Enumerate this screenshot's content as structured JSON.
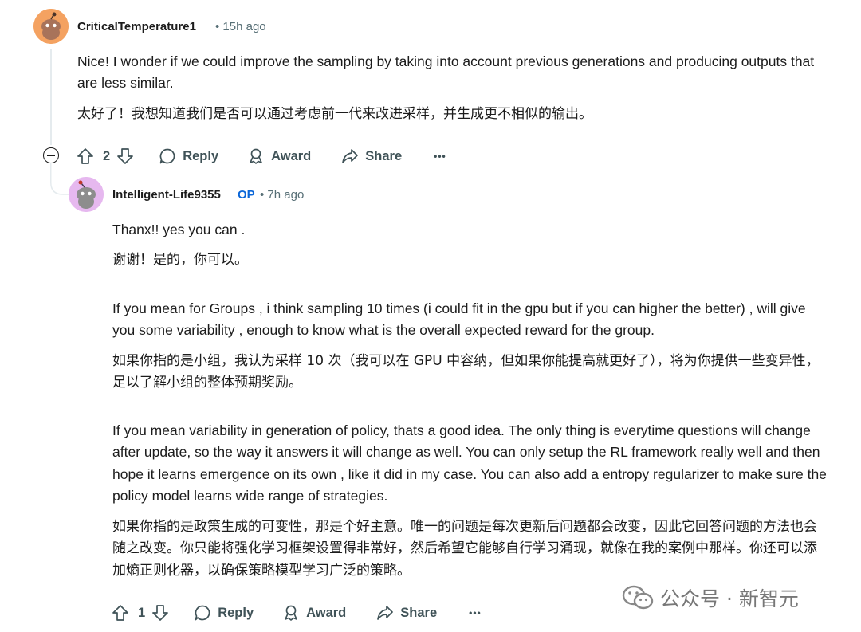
{
  "comment": {
    "username": "CriticalTemperature1",
    "time": "15h ago",
    "text_en": "Nice! I wonder if we could improve the sampling by taking into account previous generations and producing outputs that are less similar.",
    "text_cn": "太好了！我想知道我们是否可以通过考虑前一代来改进采样，并生成更不相似的输出。",
    "votes": "2",
    "reply_label": "Reply",
    "award_label": "Award",
    "share_label": "Share",
    "more_label": "•••"
  },
  "reply": {
    "username": "Intelligent-Life9355",
    "op_badge": "OP",
    "time": "7h ago",
    "p1_en": "Thanx!! yes you can .",
    "p1_cn": "谢谢！是的，你可以。",
    "p2_en": "If you mean for Groups , i think sampling 10 times (i could fit in the gpu but if you can higher the better) , will give you some variability , enough to know what is the overall expected reward for the group.",
    "p2_cn": "如果你指的是小组，我认为采样 10 次（我可以在 GPU 中容纳，但如果你能提高就更好了），将为你提供一些变异性，足以了解小组的整体预期奖励。",
    "p3_en": "If you mean variability in generation of policy, thats a good idea. The only thing is everytime questions will change after update, so the way it answers it will change as well. You can only setup the RL framework really well and then hope it learns emergence on its own , like it did in my case. You can also add a entropy regularizer to make sure the policy model learns wide range of strategies.",
    "p3_cn": "如果你指的是政策生成的可变性，那是个好主意。唯一的问题是每次更新后问题都会改变，因此它回答问题的方法也会随之改变。你只能将强化学习框架设置得非常好，然后希望它能够自行学习涌现，就像在我的案例中那样。你还可以添加熵正则化器，以确保策略模型学习广泛的策略。",
    "votes": "1",
    "reply_label": "Reply",
    "award_label": "Award",
    "share_label": "Share",
    "more_label": "•••"
  },
  "watermark": {
    "text": "公众号 · 新智元"
  },
  "colors": {
    "avatar1_bg": "#f4a261",
    "avatar2_bg": "#e6b8ef",
    "text": "#1c1c1c",
    "meta": "#576f76",
    "op": "#0a66d8"
  }
}
